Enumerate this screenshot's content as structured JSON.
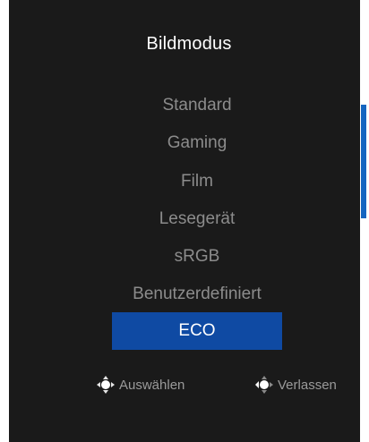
{
  "osd": {
    "title": "Bildmodus",
    "items": [
      {
        "label": "Standard",
        "selected": false
      },
      {
        "label": "Gaming",
        "selected": false
      },
      {
        "label": "Film",
        "selected": false
      },
      {
        "label": "Lesegerät",
        "selected": false
      },
      {
        "label": "sRGB",
        "selected": false
      },
      {
        "label": "Benutzerdefiniert",
        "selected": false
      },
      {
        "label": "ECO",
        "selected": true
      }
    ],
    "hints": {
      "select_label": "Auswählen",
      "select_icon": "joystick-press-icon",
      "exit_label": "Verlassen",
      "exit_icon": "joystick-left-icon"
    },
    "colors": {
      "background": "#1a1a1a",
      "highlight": "#0f4aa3",
      "scrollbar": "#1565c0",
      "item_text": "#8c8c8c"
    }
  }
}
